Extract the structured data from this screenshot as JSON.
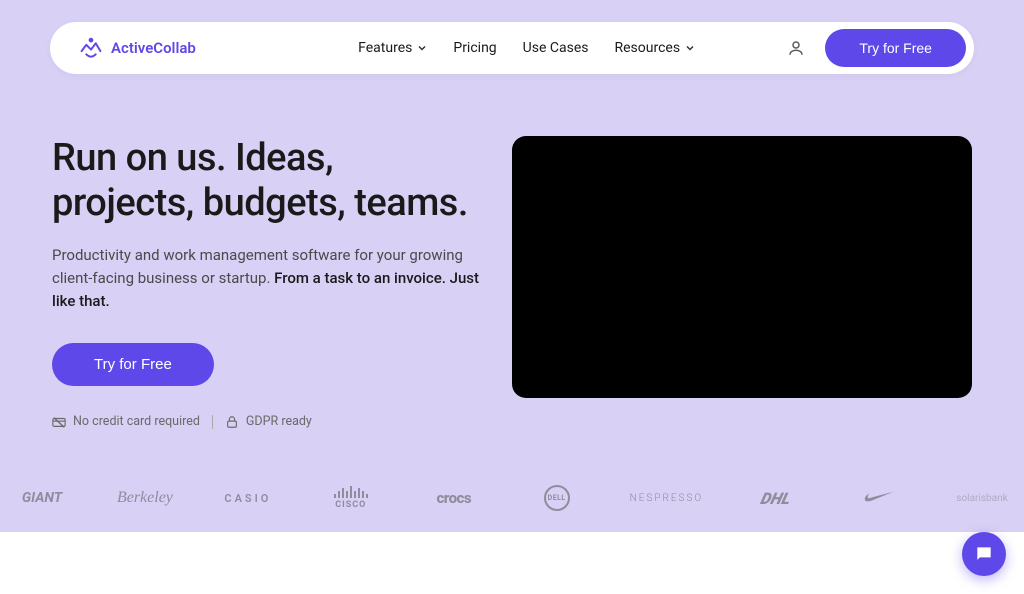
{
  "brand": {
    "name": "ActiveCollab"
  },
  "nav": {
    "items": [
      {
        "label": "Features",
        "dropdown": true
      },
      {
        "label": "Pricing",
        "dropdown": false
      },
      {
        "label": "Use Cases",
        "dropdown": false
      },
      {
        "label": "Resources",
        "dropdown": true
      }
    ],
    "cta": "Try for Free"
  },
  "hero": {
    "title": "Run on us. Ideas, projects, budgets, teams.",
    "desc_plain": "Productivity and work management software for your growing client-facing business or startup. ",
    "desc_strong": "From a task to an invoice. Just like that.",
    "cta": "Try for Free",
    "badges": {
      "no_card": "No credit card required",
      "gdpr": "GDPR ready"
    }
  },
  "logos": [
    "GIANT",
    "Berkeley",
    "CASIO",
    "CISCO",
    "crocs",
    "DELL",
    "NESPRESSO",
    "DHL",
    "nike",
    "solarisbank"
  ]
}
